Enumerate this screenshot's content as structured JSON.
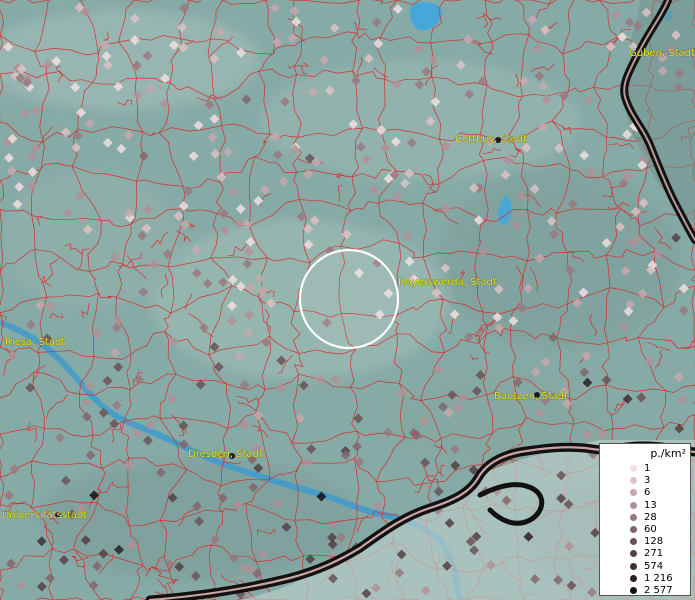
{
  "map": {
    "base_colors": {
      "land": "#86aaa6",
      "land_light": "#9fbcb6",
      "water": "#2a9fd6",
      "borders": "#e02020",
      "country_border_outer": "#111111",
      "country_border_inner": "#c9a0a0",
      "dot_light": "#f0d8dc",
      "dot_dark": "#1a1415"
    },
    "cities": [
      {
        "name": "Guben, Stadt"
      },
      {
        "name": "Cottbus, Stadt"
      },
      {
        "name": "Hoyerswerda, Stadt"
      },
      {
        "name": "Riesa, Stadt"
      },
      {
        "name": "Bautzen, Stadt"
      },
      {
        "name": "Dresden, Stadt"
      },
      {
        "name": "Universitätsstadt"
      }
    ],
    "highlight_circle": {
      "label": "selection-ring"
    }
  },
  "legend": {
    "title": "p./km²",
    "entries": [
      {
        "label": "1",
        "color": "#f1dfe1"
      },
      {
        "label": "3",
        "color": "#dcc3c6"
      },
      {
        "label": "6",
        "color": "#c7a8ad"
      },
      {
        "label": "13",
        "color": "#b09096"
      },
      {
        "label": "28",
        "color": "#98797f"
      },
      {
        "label": "60",
        "color": "#82666b"
      },
      {
        "label": "128",
        "color": "#6a5256"
      },
      {
        "label": "271",
        "color": "#534043"
      },
      {
        "label": "574",
        "color": "#3e2f31"
      },
      {
        "label": "1 216",
        "color": "#2a1f21"
      },
      {
        "label": "2 577",
        "color": "#150f10"
      }
    ]
  }
}
